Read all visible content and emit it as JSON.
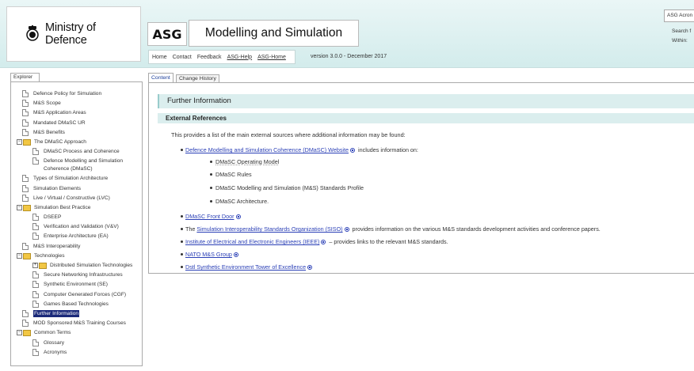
{
  "header": {
    "org_name": "Ministry of Defence",
    "asg_label": "ASG",
    "title": "Modelling and Simulation",
    "version": "version 3.0.0 - December 2017",
    "nav": [
      "Home",
      "Contact",
      "Feedback",
      "ASG-Help",
      "ASG-Home"
    ],
    "search_value": "ASG Acron",
    "search_label": "Search f",
    "within_label": "Within:"
  },
  "explorer": {
    "tab_label": "Explorer",
    "items": [
      {
        "label": "Defence Policy for Simulation",
        "type": "doc",
        "level": 0
      },
      {
        "label": "M&S Scope",
        "type": "doc",
        "level": 0
      },
      {
        "label": "M&S Application Areas",
        "type": "doc",
        "level": 0
      },
      {
        "label": "Mandated DMaSC UR",
        "type": "doc",
        "level": 0
      },
      {
        "label": "M&S Benefits",
        "type": "doc",
        "level": 0
      },
      {
        "label": "The DMaSC Approach",
        "type": "folder",
        "level": 0,
        "expander": "−"
      },
      {
        "label": "DMaSC Process and Coherence",
        "type": "doc",
        "level": 1
      },
      {
        "label": "Defence Modelling and Simulation Coherence (DMaSC)",
        "type": "doc",
        "level": 1,
        "wrap": true
      },
      {
        "label": "Types of Simulation Architecture",
        "type": "doc",
        "level": 0
      },
      {
        "label": "Simulation Elements",
        "type": "doc",
        "level": 0
      },
      {
        "label": "Live / Virtual / Constructive (LVC)",
        "type": "doc",
        "level": 0
      },
      {
        "label": "Simulation Best Practice",
        "type": "folder",
        "level": 0,
        "expander": "−"
      },
      {
        "label": "DSEEP",
        "type": "doc",
        "level": 1
      },
      {
        "label": "Verification and Validation (V&V)",
        "type": "doc",
        "level": 1
      },
      {
        "label": "Enterprise Architecture (EA)",
        "type": "doc",
        "level": 1
      },
      {
        "label": "M&S Interoperability",
        "type": "doc",
        "level": 0
      },
      {
        "label": "Technologies",
        "type": "folder",
        "level": 0,
        "expander": "−"
      },
      {
        "label": "Distributed Simulation Technologies",
        "type": "folder",
        "level": 1,
        "expander": "+"
      },
      {
        "label": "Secure Networking Infrastructures",
        "type": "doc",
        "level": 1
      },
      {
        "label": "Synthetic Environment (SE)",
        "type": "doc",
        "level": 1
      },
      {
        "label": "Computer Generated Forces (CGF)",
        "type": "doc",
        "level": 1
      },
      {
        "label": "Games Based Technologies",
        "type": "doc",
        "level": 1
      },
      {
        "label": "Further Information",
        "type": "doc",
        "level": 0,
        "selected": true
      },
      {
        "label": "MOD Sponsored M&S Training Courses",
        "type": "doc",
        "level": 0
      },
      {
        "label": "Common Terms",
        "type": "folder",
        "level": 0,
        "expander": "−"
      },
      {
        "label": "Glossary",
        "type": "doc",
        "level": 1
      },
      {
        "label": "Acronyms",
        "type": "doc",
        "level": 1
      }
    ]
  },
  "tabs": {
    "content": "Content",
    "history": "Change History"
  },
  "main": {
    "heading": "Further Information",
    "subheading": "External References",
    "intro": "This provides a list of the main external sources where additional information may be found:",
    "refs": [
      {
        "link": "Defence Modelling and Simulation Coherence (DMaSC) Website",
        "text": " includes information on:"
      },
      {
        "link": "DMaSC Front Door",
        "text": ""
      },
      {
        "prefix": "The ",
        "link": "Simulation Interoperability Standards Organization (SISO)",
        "text": " provides information on the various M&S standards development activities and conference papers."
      },
      {
        "link": "Institute of Electrical and Electronic Engineers (IEEE)",
        "text": " – provides links to the relevant M&S standards."
      },
      {
        "link": "NATO M&S Group",
        "text": ""
      },
      {
        "link": "Dstl Synthetic Environment Tower of Excellence",
        "text": ""
      }
    ],
    "subitems": [
      "DMaSC Operating Model",
      "DMaSC Rules",
      "DMaSC Modelling and Simulation (M&S) Standards Profile",
      "DMaSC Architecture."
    ]
  },
  "colors": {
    "header_bg": "#d3ecec",
    "heading_bar": "#dbeeee",
    "link": "#2a3fb6",
    "selected": "#1b2a7a"
  }
}
